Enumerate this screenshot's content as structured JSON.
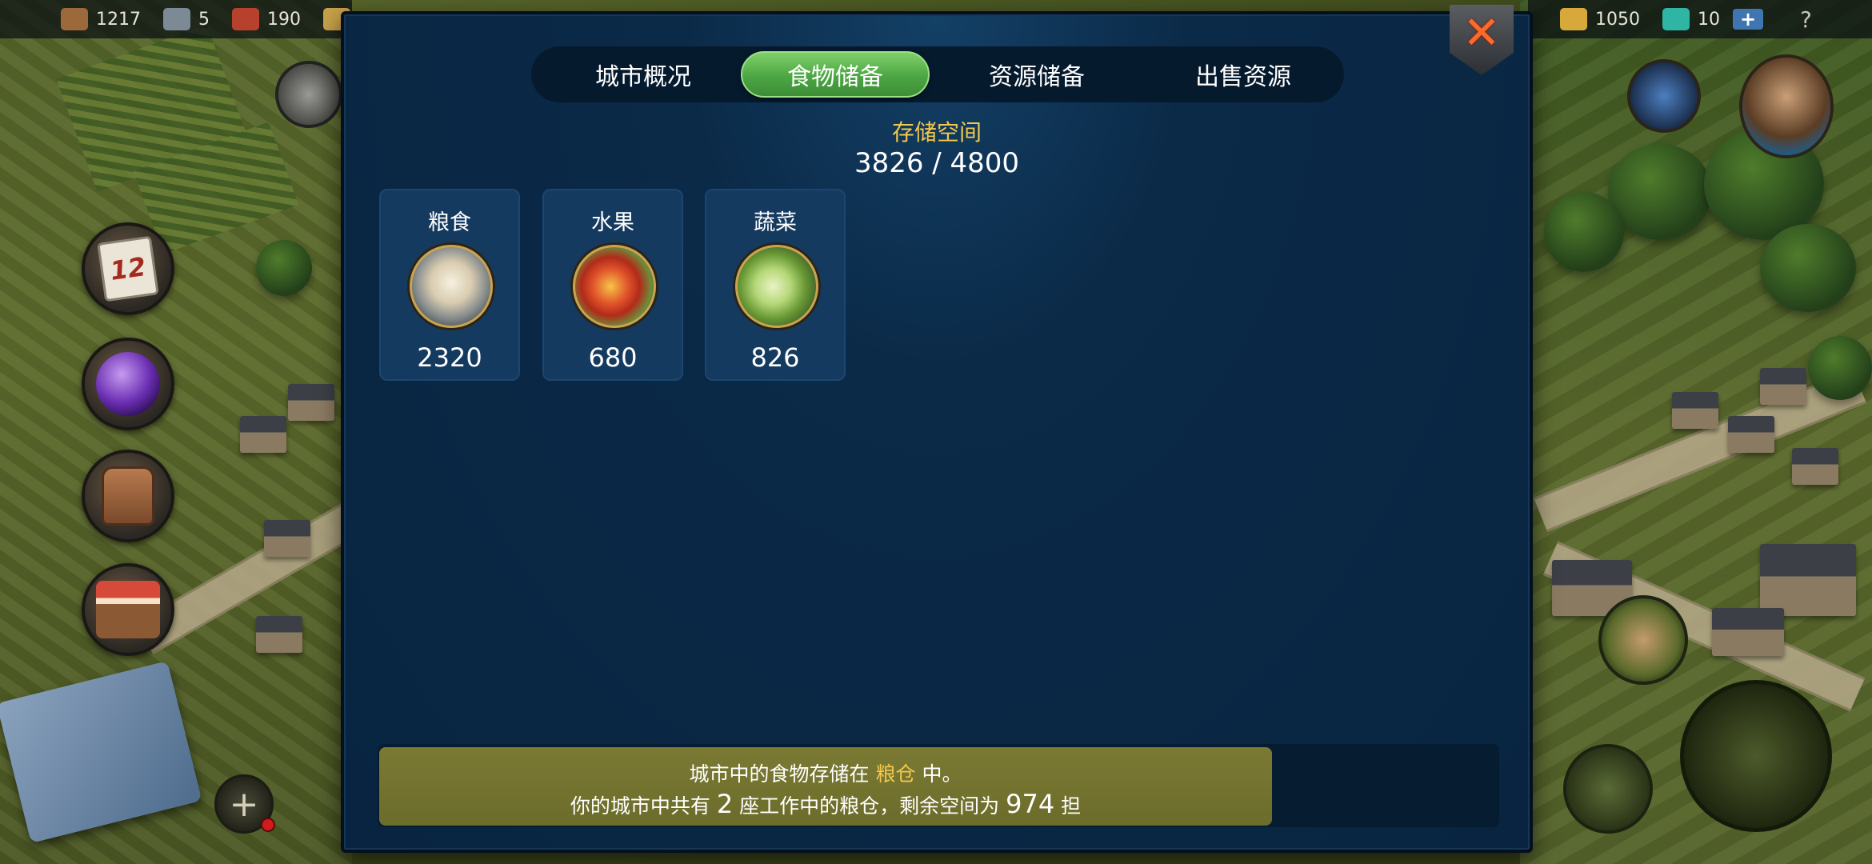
{
  "topbar_left": {
    "resources": [
      {
        "icon": "wood-icon",
        "value": "1217",
        "color": "#9c6a3a"
      },
      {
        "icon": "iron-icon",
        "value": "5",
        "color": "#7c8a96"
      },
      {
        "icon": "brick-icon",
        "value": "190",
        "color": "#b8412e"
      },
      {
        "icon": "gold-bars-icon",
        "value": "",
        "color": "#c9a24a"
      }
    ]
  },
  "topbar_right": {
    "resources": [
      {
        "icon": "gold-ingot-icon",
        "value": "1050",
        "color": "#d7a93b"
      },
      {
        "icon": "gem-icon",
        "value": "10",
        "color": "#2fb5a3"
      }
    ],
    "plus_label": "+",
    "help_label": "?"
  },
  "left_buttons": {
    "calendar_day": "12",
    "add_label": "+"
  },
  "panel": {
    "tabs": [
      {
        "label": "城市概况",
        "active": false
      },
      {
        "label": "食物储备",
        "active": true
      },
      {
        "label": "资源储备",
        "active": false
      },
      {
        "label": "出售资源",
        "active": false
      }
    ],
    "storage_title": "存储空间",
    "storage_value": "3826 / 4800",
    "foods": [
      {
        "name": "粮食",
        "icon": "grain-sack-icon",
        "value": "2320"
      },
      {
        "name": "水果",
        "icon": "apple-icon",
        "value": "680"
      },
      {
        "name": "蔬菜",
        "icon": "cabbage-icon",
        "value": "826"
      }
    ],
    "info": {
      "line1_prefix": "城市中的食物存储在 ",
      "line1_highlight": "粮仓",
      "line1_suffix": " 中。",
      "line2_prefix": "你的城市中共有 ",
      "line2_count": "2",
      "line2_middle": " 座工作中的粮仓，剩余空间为 ",
      "line2_space": "974",
      "line2_suffix": " 担"
    },
    "close_label": "✕"
  },
  "colors": {
    "panel_bg": "#082440",
    "tab_active": "#4ca643",
    "highlight": "#f2c84b",
    "info_box": "#7b7a34"
  }
}
